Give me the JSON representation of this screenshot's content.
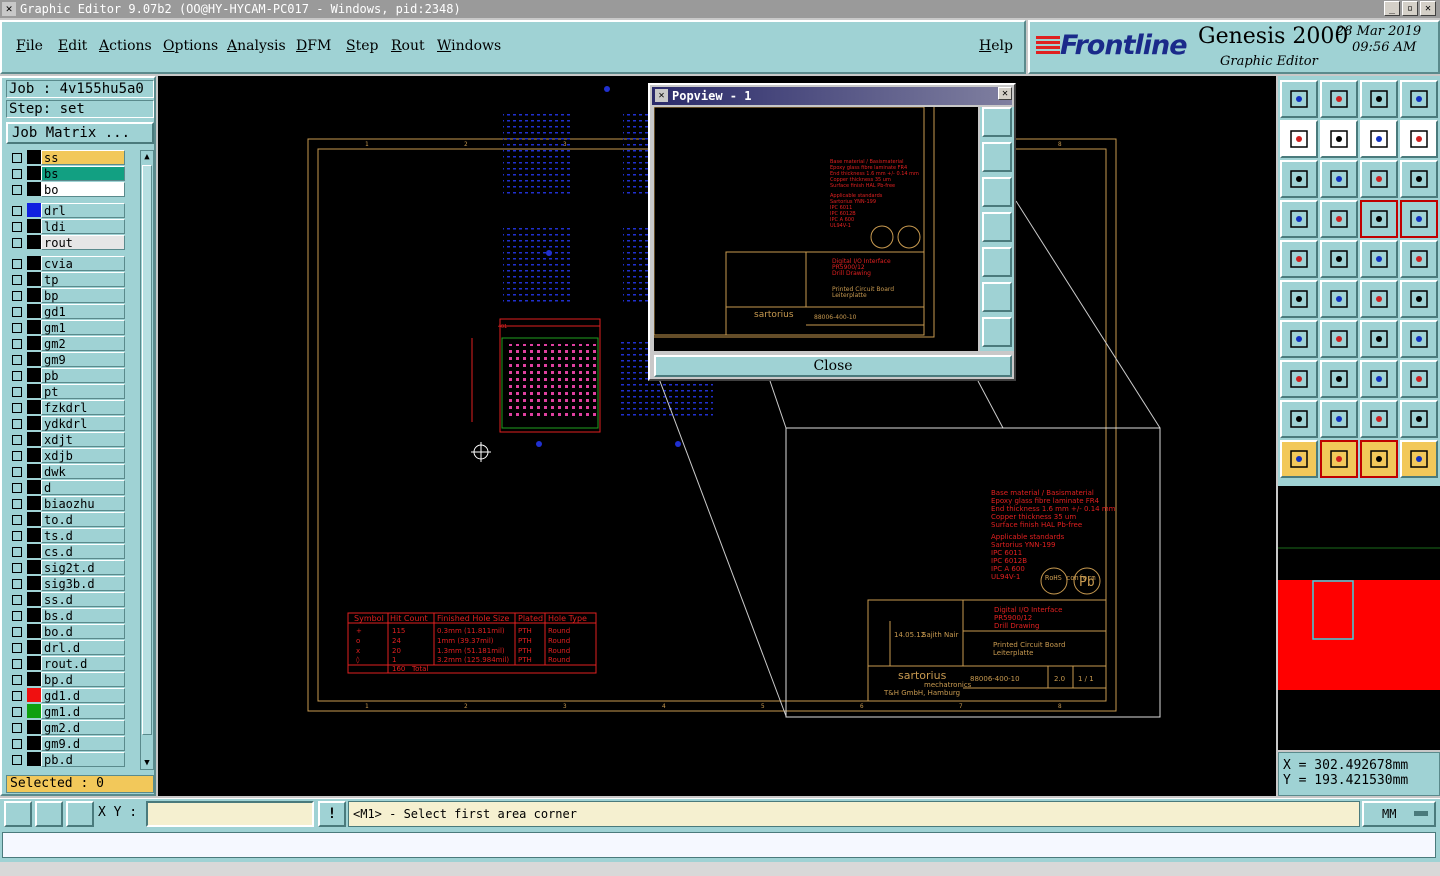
{
  "window": {
    "title": "Graphic Editor 9.07b2 (OO@HY-HYCAM-PC017 - Windows, pid:2348)"
  },
  "menu": {
    "items": [
      "File",
      "Edit",
      "Actions",
      "Options",
      "Analysis",
      "DFM",
      "Step",
      "Rout",
      "Windows"
    ],
    "help": "Help"
  },
  "brand": {
    "logo": "Frontline",
    "product": "Genesis 2000",
    "subtitle": "Graphic Editor",
    "date": "28 Mar 2019",
    "time": "09:56 AM"
  },
  "job": {
    "job_label": "Job : 4v155hu5a0",
    "step_label": "Step: set",
    "matrix_button": "Job Matrix ..."
  },
  "layers": [
    {
      "name": "ss",
      "color": "#f2c85a",
      "swatch": "#000000"
    },
    {
      "name": "bs",
      "color": "#12a082",
      "swatch": "#000000"
    },
    {
      "name": "bo",
      "color": "#ffffff",
      "swatch": "#000000"
    },
    {
      "name": "drl",
      "color": "#9fd2d4",
      "swatch": "#1020e0"
    },
    {
      "name": "ldi",
      "color": "#9fd2d4",
      "swatch": "#000000"
    },
    {
      "name": "rout",
      "color": "#e6e6e6",
      "swatch": "#000000"
    },
    {
      "name": "cvia",
      "color": "#9fd2d4",
      "swatch": "#000000"
    },
    {
      "name": "tp",
      "color": "#9fd2d4",
      "swatch": "#000000"
    },
    {
      "name": "bp",
      "color": "#9fd2d4",
      "swatch": "#000000"
    },
    {
      "name": "gd1",
      "color": "#9fd2d4",
      "swatch": "#000000"
    },
    {
      "name": "gm1",
      "color": "#9fd2d4",
      "swatch": "#000000"
    },
    {
      "name": "gm2",
      "color": "#9fd2d4",
      "swatch": "#000000"
    },
    {
      "name": "gm9",
      "color": "#9fd2d4",
      "swatch": "#000000"
    },
    {
      "name": "pb",
      "color": "#9fd2d4",
      "swatch": "#000000"
    },
    {
      "name": "pt",
      "color": "#9fd2d4",
      "swatch": "#000000"
    },
    {
      "name": "fzkdrl",
      "color": "#9fd2d4",
      "swatch": "#000000"
    },
    {
      "name": "ydkdrl",
      "color": "#9fd2d4",
      "swatch": "#000000"
    },
    {
      "name": "xdjt",
      "color": "#9fd2d4",
      "swatch": "#000000"
    },
    {
      "name": "xdjb",
      "color": "#9fd2d4",
      "swatch": "#000000"
    },
    {
      "name": "dwk",
      "color": "#9fd2d4",
      "swatch": "#000000"
    },
    {
      "name": "d",
      "color": "#9fd2d4",
      "swatch": "#000000"
    },
    {
      "name": "biaozhu",
      "color": "#9fd2d4",
      "swatch": "#000000"
    },
    {
      "name": "to.d",
      "color": "#9fd2d4",
      "swatch": "#000000",
      "mark": "⸗"
    },
    {
      "name": "ts.d",
      "color": "#9fd2d4",
      "swatch": "#000000",
      "mark": "⸗"
    },
    {
      "name": "cs.d",
      "color": "#9fd2d4",
      "swatch": "#000000",
      "mark": "⸗"
    },
    {
      "name": "sig2t.d",
      "color": "#9fd2d4",
      "swatch": "#000000",
      "mark": "⸗"
    },
    {
      "name": "sig3b.d",
      "color": "#9fd2d4",
      "swatch": "#000000",
      "mark": "⸗"
    },
    {
      "name": "ss.d",
      "color": "#9fd2d4",
      "swatch": "#000000",
      "mark": "⸗"
    },
    {
      "name": "bs.d",
      "color": "#9fd2d4",
      "swatch": "#000000",
      "mark": "⸗"
    },
    {
      "name": "bo.d",
      "color": "#9fd2d4",
      "swatch": "#000000",
      "mark": "⸗"
    },
    {
      "name": "drl.d",
      "color": "#9fd2d4",
      "swatch": "#000000"
    },
    {
      "name": "rout.d",
      "color": "#9fd2d4",
      "swatch": "#000000"
    },
    {
      "name": "bp.d",
      "color": "#9fd2d4",
      "swatch": "#000000",
      "mark": "⸗"
    },
    {
      "name": "gd1.d",
      "color": "#9fd2d4",
      "swatch": "#f01010",
      "mark": "⸗ ⊞"
    },
    {
      "name": "gm1.d",
      "color": "#9fd2d4",
      "swatch": "#10a010",
      "mark": "⸗"
    },
    {
      "name": "gm2.d",
      "color": "#9fd2d4",
      "swatch": "#000000",
      "mark": "⸗"
    },
    {
      "name": "gm9.d",
      "color": "#9fd2d4",
      "swatch": "#000000",
      "mark": "⸗"
    },
    {
      "name": "pb.d",
      "color": "#9fd2d4",
      "swatch": "#000000",
      "mark": "⸗"
    }
  ],
  "selected_label": "Selected : 0",
  "popview": {
    "title": "Popview - 1",
    "close_button": "Close"
  },
  "drawing": {
    "notes": [
      "Base material / Basismaterial",
      "Epoxy glass fibre laminate FR4",
      "End thickness 1.6 mm +/- 0.14 mm",
      "Copper thickness 35 um",
      "Surface finish HAL Pb-free",
      "Applicable standards",
      "Sartorius YNN-199",
      "IPC 6011",
      "IPC 6012B",
      "IPC A 600",
      "UL94V-1"
    ],
    "rohs": "RoHS conform",
    "pb": "Pb",
    "title_block": {
      "title1": "Digital I/O  Interface",
      "title2": "PR5900/12",
      "title3": "Drill Drawing",
      "desc1": "Printed Circuit Board",
      "desc2": "Leiterplatte",
      "company": "sartorius",
      "company_sub": "mechatronics",
      "company_addr": "T&H GmbH, Hamburg",
      "drawing_no": "88006-400-10",
      "revision": "2.0",
      "sheet": "1 / 1",
      "date": "14.05.12",
      "author": "Sajith Nair"
    },
    "drill_table": {
      "headers": [
        "Symbol",
        "Hit Count",
        "Finished Hole Size",
        "Plated",
        "Hole Type"
      ],
      "rows": [
        [
          "+",
          "115",
          "0.3mm (11.811mil)",
          "PTH",
          "Round"
        ],
        [
          "o",
          "24",
          "1mm (39.37mil)",
          "PTH",
          "Round"
        ],
        [
          "x",
          "20",
          "1.3mm (51.181mil)",
          "PTH",
          "Round"
        ],
        [
          "◊",
          "1",
          "3.2mm (125.984mil)",
          "PTH",
          "Round"
        ]
      ],
      "total_count": "160",
      "total_label": "Total"
    }
  },
  "coords": {
    "x": "X = 302.492678mm",
    "y": "Y = 193.421530mm"
  },
  "bottom": {
    "xy_label": "X Y :",
    "xy_value": "",
    "info_button": "!",
    "prompt": "<M1> - Select first area corner",
    "units": "MM"
  },
  "tools": [
    "snap-icon",
    "move-icon",
    "home-icon",
    "window-icon",
    "left-icon",
    "right-icon",
    "swap-icon",
    "step-icon",
    "fit-icon",
    "zoom-icon",
    "ratio-icon",
    "help-icon",
    "measure-icon",
    "probe-icon",
    "layers-icon",
    "layers2-icon",
    "select-icon",
    "ruler-icon",
    "grid-icon",
    "circle-icon",
    "net-icon",
    "cross-icon",
    "line-icon",
    "line2-icon",
    "angle-icon",
    "slash-icon",
    "arc-icon",
    "dim-icon",
    "pad-icon",
    "minus-icon",
    "bar-icon",
    "blobs-icon",
    "tri-icon",
    "tri2-icon",
    "tri3-icon",
    "tri4-icon",
    "pointer-icon",
    "pointer2-icon",
    "pointer3-icon",
    "route-icon"
  ]
}
